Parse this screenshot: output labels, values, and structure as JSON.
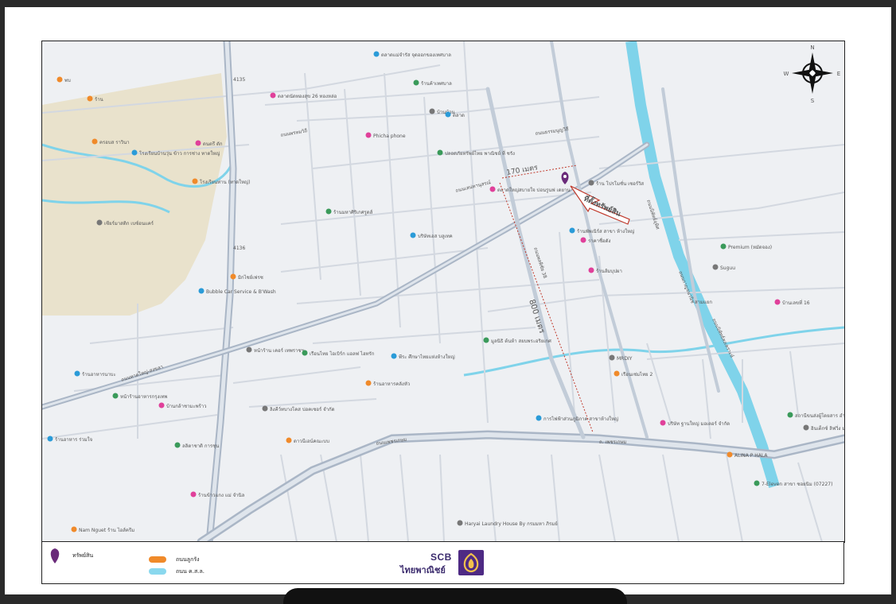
{
  "map": {
    "compass": {
      "n": "N",
      "s": "S",
      "e": "E",
      "w": "W"
    },
    "annotations": {
      "distance_short": "170 เมตร",
      "distance_long": "800 เมตร",
      "property_label": "ที่ตั้งทรัพย์สิน"
    },
    "place_labels": [
      "พบ",
      "ตลาดแม่จำรัส จุดออกของเทศบาล",
      "ตลาดนัดทองสุข 26 ทองหล่อ",
      "ร้านค้าเทศบาล",
      "บ้านบ้าน",
      "ร้าน",
      "ตลาด",
      "Phicha phone",
      "ปลอดภัยทรัพย์ไทย พาณิชย์ ที่ ชรัง",
      "ร้าน โปรโมชั่น เซอร์วิส",
      "ครอบส ราวินา",
      "โรงเรียนบ้านวุ่น ข้าว การช่าง ทาดใหญ่",
      "ดนตรี ดัก",
      "ร้านมหาศิริเกศรูดส์",
      "เซียร์มาสติก เบซ์อนแคร์",
      "โรงเรียนท่าน (ทาดใหญ่)",
      "บริษัทเอส บลูเทค",
      "ตลาดใหญ่สบายใจ บ่อนรูนฟ เดยาน",
      "Premium (หมัดจอง)",
      "Suguu",
      "มิกไชย์เฟรซ",
      "Bubble Car Service & B'Wash",
      "ร้านส้มบุปผา",
      "มูลนิธิ ต้นห้า สยบพระอริยเกศ",
      "หน้าร้าน เคอร์ เทพราชฯ",
      "ร้านอาหารคลังหัว",
      "พีระ ศึกษาไทยแห่งห้างใหญ่",
      "บ้านเลขที่ 16",
      "เรือนไทย ไอเบิร์ก แอลฟ ไฮทรัก",
      "MRDIY",
      "เรือนเซ่มไทย 2",
      "ร้านอาหารนาบะ",
      "บ้านกล้าชามะพร้าว",
      "ลลิตาชาติ การชุน",
      "ลิงคีว์ทบางโคส บ่อคเซอร์ จำกัด",
      "ดาวนีเอน์คณะบบ",
      "การไฟฟ้าส่วนภูมิภาค สาขาห้างใหญ่",
      "บริษัท ฐานใหญ่ มอเตอร์ จำกัด",
      "สถานีขนส่งผู้โดยสาร อำเภอท่าใหญ่",
      "อินเด็กซ์ ลิฟวิ่ง มอลล์ สาขา",
      "ALINA P HALA",
      "ร้านอาหาร ร่วมใจ",
      "ร้านข้าวแกง แม่ จำนิล",
      "7-Eleven สาขา ซอยนิม (07227)",
      "Haryai Laundry House By กรมมหา ภิรมย์",
      "Nam Nguet ร้าน ไอส์ครีม",
      "ร้านพัพเนิร์ส สาขา ห้างใหญ่",
      "ราคาชื่อดัง",
      "หน้าร้านอาหารกรุงเทพ"
    ],
    "road_labels": [
      "ถนนเพชรเกษม",
      "ถ. เพชรเกษม",
      "ถนนหาดใหญ่-สงขลา",
      "ถนนพรหมวิถี",
      "ถนนธรรมนูญวิถี",
      "ถนนเสน่หานุสรณ์",
      "ถนนพลพิชัย 38",
      "ถนนนิพัทธ์อุทิศ",
      "ถนนกาญจนวนิช",
      "ถนนนิพัทธ์สงเคราะห์",
      "สามแยก",
      "4135",
      "4136"
    ]
  },
  "legend": {
    "items": [
      {
        "label": "ทรัพย์สิน",
        "icon": "map-pin-icon",
        "color": "#6a2a7a"
      },
      {
        "label": "ถนนลูกรัง",
        "icon": "orange-pill",
        "color": "#f08a2a"
      },
      {
        "label": "ถนน ค.ส.ล.",
        "icon": "cyan-pill",
        "color": "#8ad8ee"
      }
    ]
  },
  "bank": {
    "name_en": "SCB",
    "name_th": "ไทยพาณิชย์"
  },
  "colors": {
    "water": "#7fd3ea",
    "road_major": "#aab6c6",
    "road_minor": "#ffffff",
    "land": "#eef0f3",
    "park": "#e8e0c8",
    "annotation_red": "#c0392b",
    "property_pin": "#6a2a7a"
  }
}
